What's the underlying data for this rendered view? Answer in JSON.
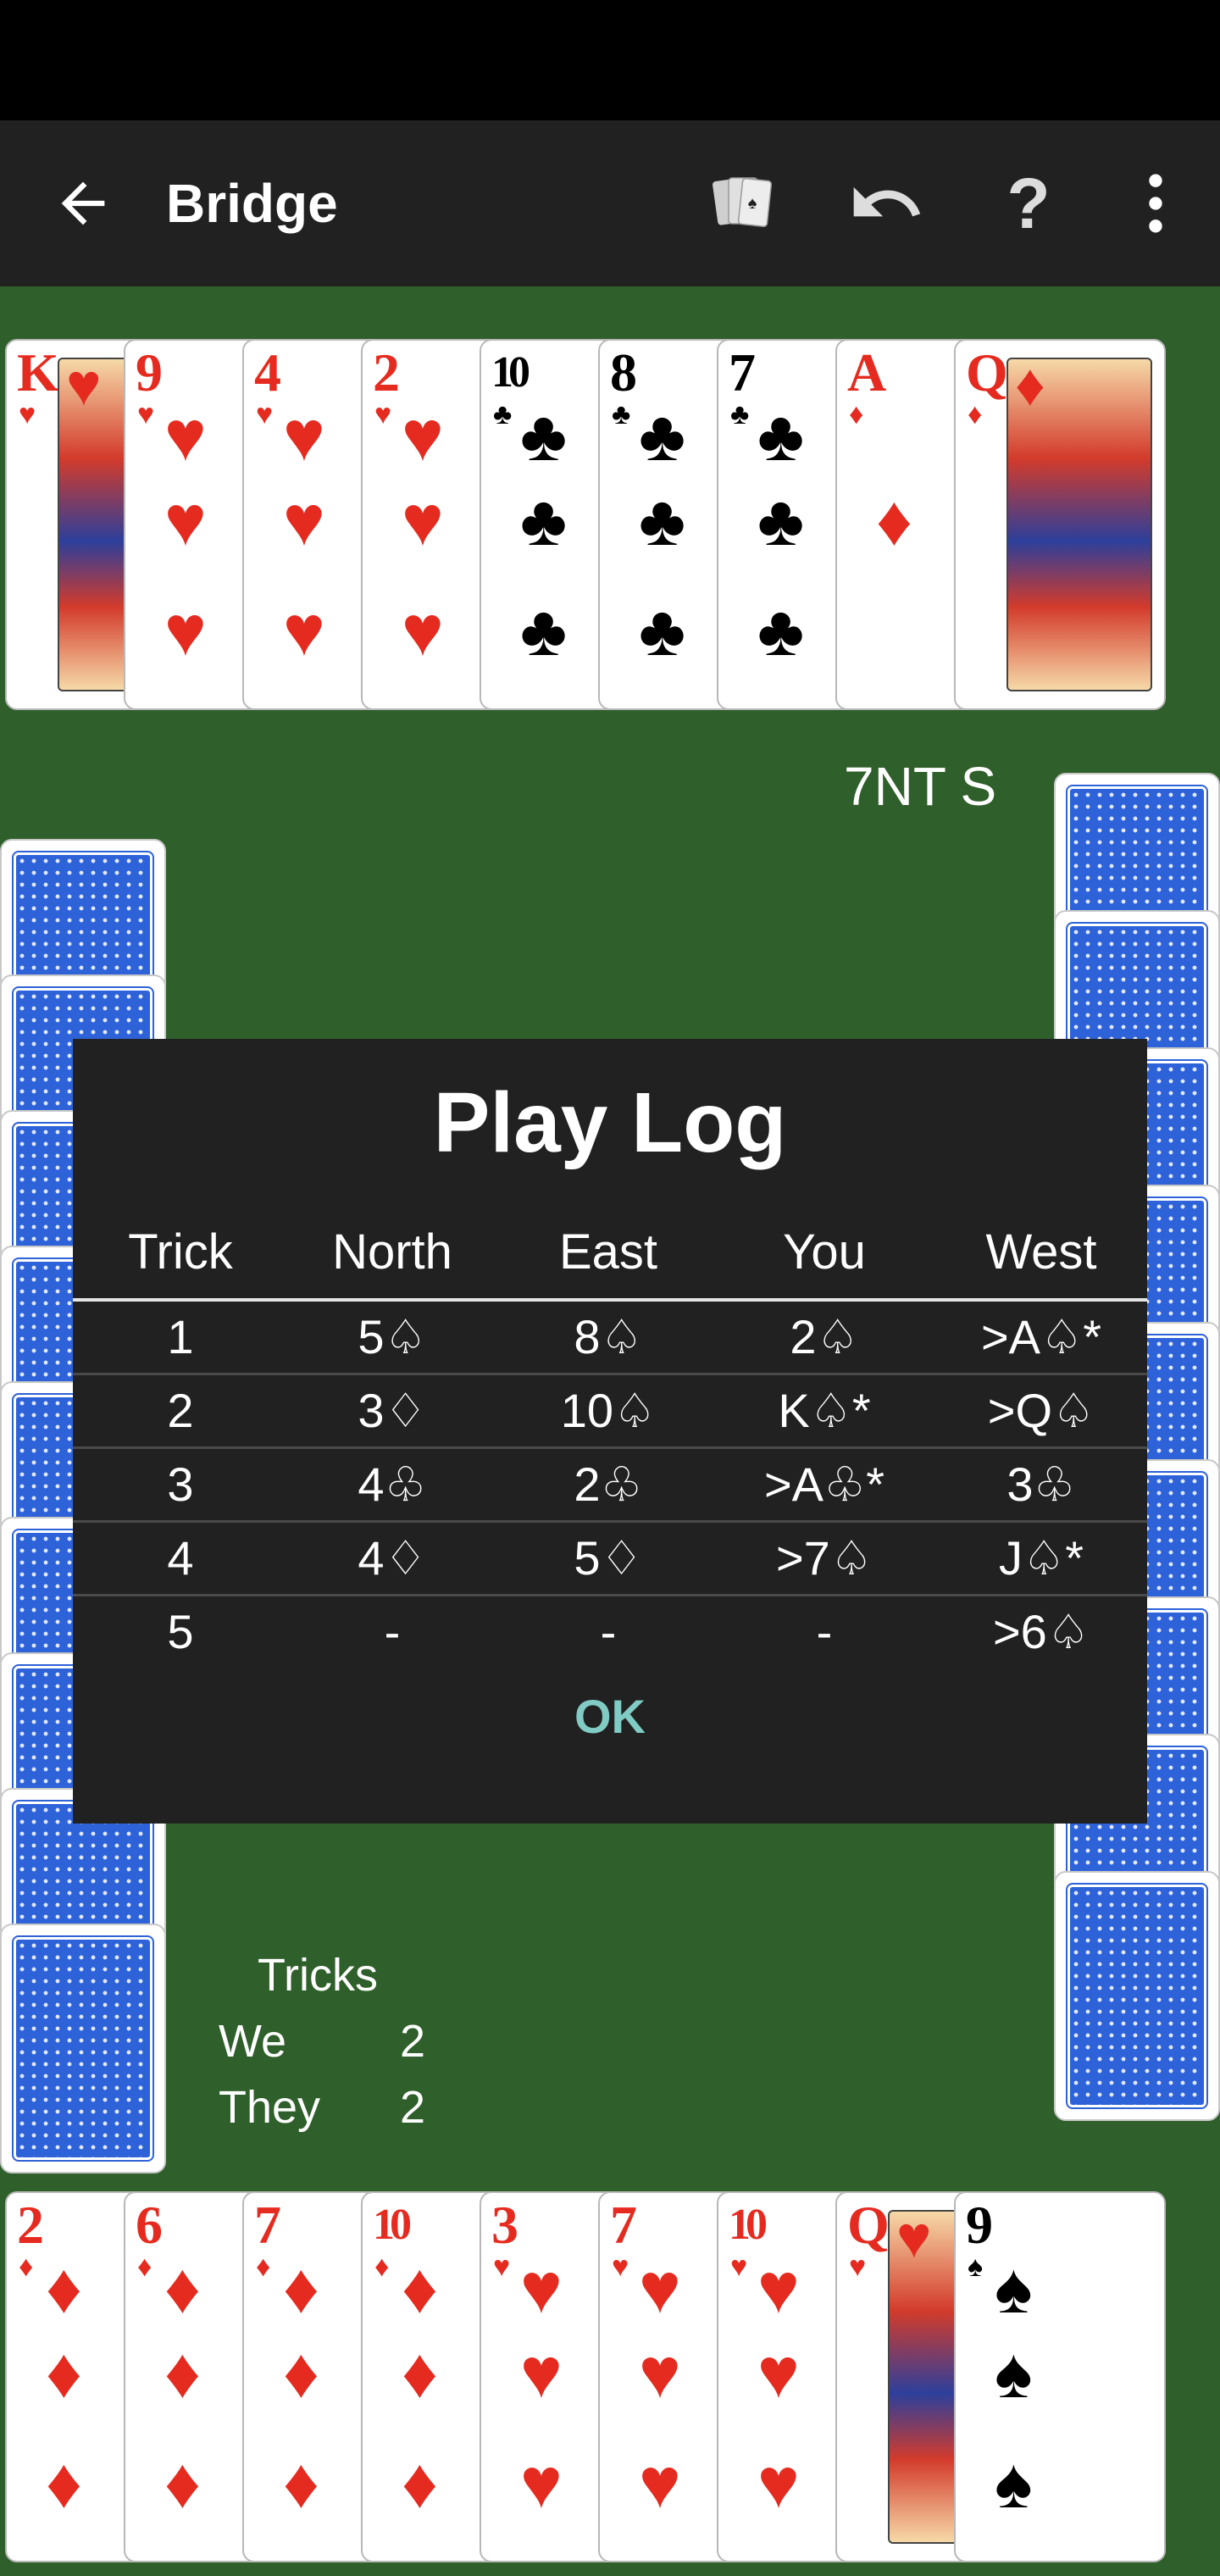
{
  "app": {
    "title": "Bridge"
  },
  "contract": "7NT S",
  "north_hand": [
    {
      "rank": "K",
      "suit": "♥",
      "color": "red",
      "face": true
    },
    {
      "rank": "9",
      "suit": "♥",
      "color": "red"
    },
    {
      "rank": "4",
      "suit": "♥",
      "color": "red"
    },
    {
      "rank": "2",
      "suit": "♥",
      "color": "red"
    },
    {
      "rank": "10",
      "suit": "♣",
      "color": "black"
    },
    {
      "rank": "8",
      "suit": "♣",
      "color": "black"
    },
    {
      "rank": "7",
      "suit": "♣",
      "color": "black"
    },
    {
      "rank": "A",
      "suit": "♦",
      "color": "red"
    },
    {
      "rank": "Q",
      "suit": "♦",
      "color": "red",
      "face": true
    }
  ],
  "south_hand": [
    {
      "rank": "2",
      "suit": "♦",
      "color": "red"
    },
    {
      "rank": "6",
      "suit": "♦",
      "color": "red"
    },
    {
      "rank": "7",
      "suit": "♦",
      "color": "red"
    },
    {
      "rank": "10",
      "suit": "♦",
      "color": "red"
    },
    {
      "rank": "3",
      "suit": "♥",
      "color": "red"
    },
    {
      "rank": "7",
      "suit": "♥",
      "color": "red"
    },
    {
      "rank": "10",
      "suit": "♥",
      "color": "red"
    },
    {
      "rank": "Q",
      "suit": "♥",
      "color": "red",
      "face": true
    },
    {
      "rank": "9",
      "suit": "♠",
      "color": "black"
    }
  ],
  "tricks": {
    "title": "Tricks",
    "we_label": "We",
    "we": "2",
    "they_label": "They",
    "they": "2"
  },
  "dialog": {
    "title": "Play Log",
    "columns": [
      "Trick",
      "North",
      "East",
      "You",
      "West"
    ],
    "rows": [
      [
        "1",
        "5♤",
        "8♤",
        "2♤",
        ">A♤*"
      ],
      [
        "2",
        "3♢",
        "10♤",
        "K♤*",
        ">Q♤"
      ],
      [
        "3",
        "4♧",
        "2♧",
        ">A♧*",
        "3♧"
      ],
      [
        "4",
        "4♢",
        "5♢",
        ">7♤",
        "J♤*"
      ],
      [
        "5",
        "-",
        "-",
        "-",
        ">6♤"
      ]
    ],
    "ok_label": "OK"
  }
}
